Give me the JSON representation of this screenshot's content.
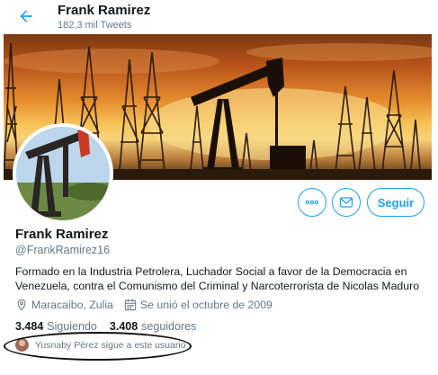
{
  "header": {
    "name": "Frank Ramirez",
    "tweet_count": "182,3 mil Tweets"
  },
  "profile": {
    "name": "Frank Ramirez",
    "handle": "@FrankRamirez16",
    "bio": "Formado en la Industria Petrolera, Luchador Social a favor de la Democracia en Venezuela, contra el Comunismo del Criminal y Narcoterrorista de Nicolas Maduro",
    "location": "Maracaibo, Zulia",
    "joined": "Se unió el octubre de 2009"
  },
  "stats": {
    "following_count": "3.484",
    "following_label": "Siguiendo",
    "followers_count": "3.408",
    "followers_label": "seguidores"
  },
  "followed_by": "Yusnaby Pérez sigue a este usuario",
  "actions": {
    "more_glyph": "•••",
    "follow_label": "Seguir"
  },
  "icons": [
    "back-arrow-icon",
    "more-icon",
    "message-icon",
    "location-icon",
    "calendar-icon"
  ],
  "colors": {
    "accent": "#1da1f2",
    "secondary_text": "#657786",
    "primary_text": "#14171a"
  }
}
